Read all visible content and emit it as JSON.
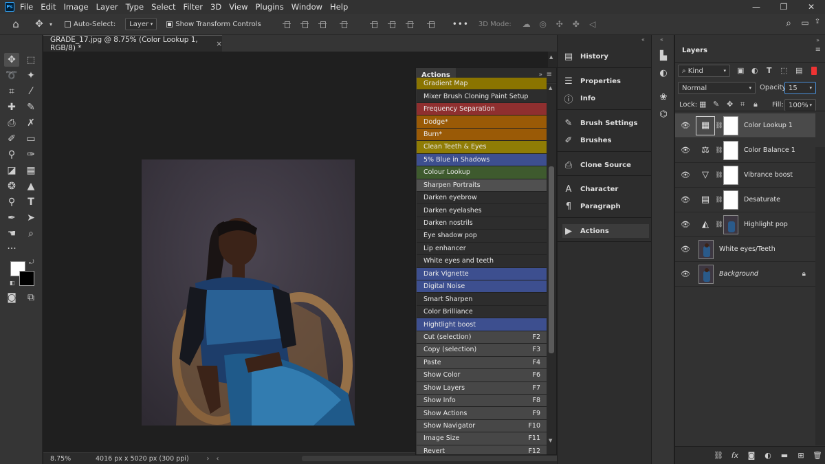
{
  "app": {
    "logo": "Ps"
  },
  "menu": [
    "File",
    "Edit",
    "Image",
    "Layer",
    "Type",
    "Select",
    "Filter",
    "3D",
    "View",
    "Plugins",
    "Window",
    "Help"
  ],
  "window_controls": {
    "minimize": "—",
    "restore": "❐",
    "close": "✕"
  },
  "options_bar": {
    "auto_select_label": "Auto-Select:",
    "auto_select_checked": false,
    "auto_select_target": "Layer",
    "transform_label": "Show Transform Controls",
    "transform_checked": true,
    "more": "•••",
    "mode_3d_label": "3D Mode:"
  },
  "document": {
    "tab_title": "GRADE_17.jpg @ 8.75% (Color Lookup 1, RGB/8) *",
    "tab_close": "×",
    "zoom": "8.75%",
    "doc_info": "4016 px x 5020 px (300 ppi)"
  },
  "actions_panel": {
    "title": "Actions",
    "items": [
      {
        "label": "Gradient Map",
        "color": "#8a7400",
        "key": ""
      },
      {
        "label": "Mixer Brush Cloning Paint Setup",
        "color": "#2d2d2d",
        "key": ""
      },
      {
        "label": "Frequency Separation",
        "color": "#8f2f2f",
        "key": ""
      },
      {
        "label": "Dodge*",
        "color": "#9a5a06",
        "key": ""
      },
      {
        "label": "Burn*",
        "color": "#9a5a06",
        "key": ""
      },
      {
        "label": "Clean Teeth & Eyes",
        "color": "#8f7c05",
        "key": ""
      },
      {
        "label": "5% Blue in Shadows",
        "color": "#3d4f8f",
        "key": ""
      },
      {
        "label": "Colour Lookup",
        "color": "#3e5a2e",
        "key": ""
      },
      {
        "label": "Sharpen Portraits",
        "color": "#505050",
        "key": ""
      },
      {
        "label": "Darken eyebrow",
        "color": "#2d2d2d",
        "key": ""
      },
      {
        "label": "Darken eyelashes",
        "color": "#2d2d2d",
        "key": ""
      },
      {
        "label": "Darken nostrils",
        "color": "#2d2d2d",
        "key": ""
      },
      {
        "label": "Eye shadow pop",
        "color": "#2d2d2d",
        "key": ""
      },
      {
        "label": "Lip enhancer",
        "color": "#2d2d2d",
        "key": ""
      },
      {
        "label": "White eyes and teeth",
        "color": "#2d2d2d",
        "key": ""
      },
      {
        "label": "Dark Vignette",
        "color": "#3d4f8f",
        "key": ""
      },
      {
        "label": "Digital Noise",
        "color": "#3d4f8f",
        "key": ""
      },
      {
        "label": "Smart Sharpen",
        "color": "#2d2d2d",
        "key": ""
      },
      {
        "label": "Color Brilliance",
        "color": "#2d2d2d",
        "key": ""
      },
      {
        "label": "Hightlight boost",
        "color": "#3d4f8f",
        "key": ""
      },
      {
        "label": "Cut (selection)",
        "color": "#474747",
        "key": "F2"
      },
      {
        "label": "Copy (selection)",
        "color": "#474747",
        "key": "F3"
      },
      {
        "label": "Paste",
        "color": "#474747",
        "key": "F4"
      },
      {
        "label": "Show Color",
        "color": "#474747",
        "key": "F6"
      },
      {
        "label": "Show Layers",
        "color": "#474747",
        "key": "F7"
      },
      {
        "label": "Show Info",
        "color": "#474747",
        "key": "F8"
      },
      {
        "label": "Show Actions",
        "color": "#474747",
        "key": "F9"
      },
      {
        "label": "Show Navigator",
        "color": "#474747",
        "key": "F10"
      },
      {
        "label": "Image Size",
        "color": "#474747",
        "key": "F11"
      },
      {
        "label": "Revert",
        "color": "#474747",
        "key": "F12"
      }
    ]
  },
  "dock_panels": [
    {
      "label": "History",
      "icon": "history-icon",
      "glyph": "▤"
    },
    {
      "label": "Properties",
      "icon": "properties-icon",
      "glyph": "☰"
    },
    {
      "label": "Info",
      "icon": "info-icon",
      "glyph": "ⓘ"
    },
    {
      "label": "Brush Settings",
      "icon": "brush-settings-icon",
      "glyph": "✎"
    },
    {
      "label": "Brushes",
      "icon": "brushes-icon",
      "glyph": "✐"
    },
    {
      "label": "Clone Source",
      "icon": "clone-source-icon",
      "glyph": "⎙"
    },
    {
      "label": "Character",
      "icon": "character-icon",
      "glyph": "A"
    },
    {
      "label": "Paragraph",
      "icon": "paragraph-icon",
      "glyph": "¶"
    },
    {
      "label": "Actions",
      "icon": "play-icon",
      "glyph": "▶"
    }
  ],
  "layers_panel": {
    "title": "Layers",
    "filter_kind": "Kind",
    "blend_mode": "Normal",
    "opacity_label": "Opacity:",
    "opacity_value": "15",
    "lock_label": "Lock:",
    "fill_label": "Fill:",
    "fill_value": "100%",
    "layers": [
      {
        "name": "Color Lookup 1",
        "type": "adjustment",
        "glyph": "▦",
        "icon": "color-lookup-icon",
        "selected": true,
        "mask": true
      },
      {
        "name": "Color Balance 1",
        "type": "adjustment",
        "glyph": "⚖",
        "icon": "color-balance-icon",
        "selected": false,
        "mask": true
      },
      {
        "name": "Vibrance boost",
        "type": "adjustment",
        "glyph": "▽",
        "icon": "vibrance-icon",
        "selected": false,
        "mask": true
      },
      {
        "name": "Desaturate",
        "type": "adjustment",
        "glyph": "▤",
        "icon": "hue-saturation-icon",
        "selected": false,
        "mask": true
      },
      {
        "name": "Highlight pop",
        "type": "adjustment-photo",
        "glyph": "◭",
        "icon": "levels-icon",
        "selected": false,
        "mask": false
      },
      {
        "name": "White eyes/Teeth",
        "type": "pixel",
        "glyph": "",
        "icon": "",
        "selected": false,
        "mask": false
      },
      {
        "name": "Background",
        "type": "background",
        "glyph": "",
        "icon": "",
        "selected": false,
        "mask": false
      }
    ]
  },
  "colors": {
    "panel_bg": "#323232",
    "foreground_swatch": "#ffffff",
    "background_swatch": "#000000",
    "selection": "#4a4a4a"
  }
}
